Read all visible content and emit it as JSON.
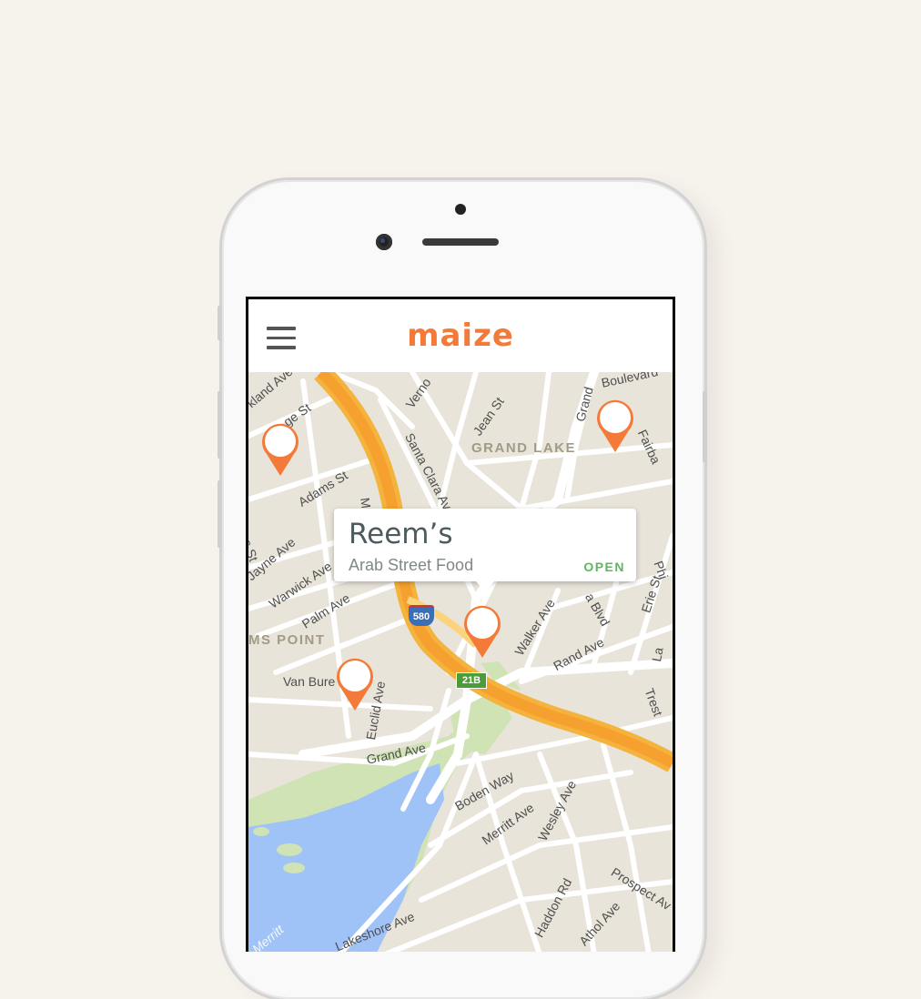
{
  "app": {
    "brand": "maize",
    "brand_color": "#f47a3a",
    "menu_icon": "hamburger-menu-icon"
  },
  "callout": {
    "name": "Reem’s",
    "cuisine": "Arab Street Food",
    "status": "OPEN",
    "status_color": "#5cb85c"
  },
  "map": {
    "pin_icon": "map-pin-icon",
    "pin_color": "#f47a3a",
    "streets": {
      "oakland_ave": "kland Ave",
      "grange_st": "ge St",
      "vernon": "Verno",
      "santa_clara": "Santa Clara Ave",
      "jean_st": "Jean St",
      "grand": "Grand",
      "boulevard": "Boulevard",
      "fairbanks": "Fairba",
      "adams_st": "Adams St",
      "mac": "Ma",
      "perkins_st": "kins St",
      "jayne_ave": "Jayne Ave",
      "warwick_ave": "Warwick Ave",
      "palm_ave": "Palm Ave",
      "van_buren": "Van Bure",
      "euclid_ave": "Euclid Ave",
      "grand_ave": "Grand Ave",
      "walker_ave": "Walker Ave",
      "rand_ave": "Rand Ave",
      "lakeshore_blvd": "a Blvd",
      "erie_st": "Erie St",
      "phi": "Phi",
      "la": "La",
      "trestle": "Trest",
      "boden_way": "Boden Way",
      "merritt_ave": "Merritt Ave",
      "wesley_ave": "Wesley Ave",
      "haddon_rd": "Haddon Rd",
      "athol_ave": "Athol Ave",
      "prospect_ave": "Prospect Av",
      "lakeshore_ave": "Lakeshore Ave",
      "merritt": "Merritt"
    },
    "areas": {
      "grand_lake": "GRAND LAKE",
      "adams_point": "MS POINT"
    },
    "shields": {
      "interstate": "580",
      "exit": "21B"
    }
  }
}
